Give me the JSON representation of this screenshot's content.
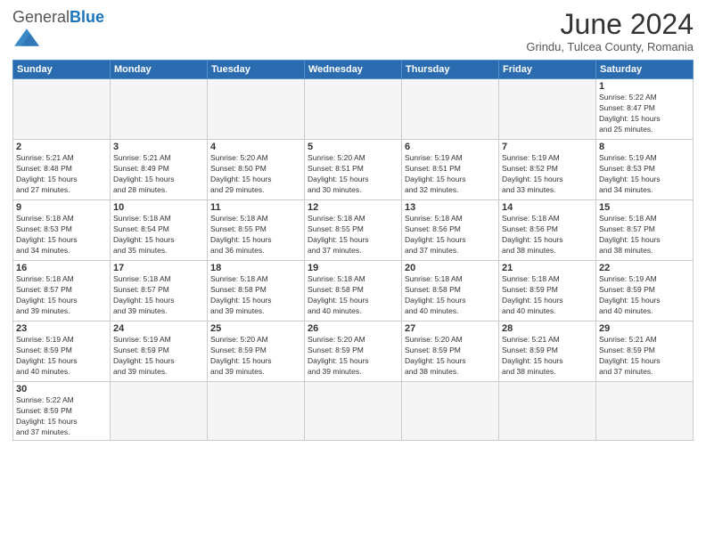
{
  "header": {
    "logo_general": "General",
    "logo_blue": "Blue",
    "month_year": "June 2024",
    "location": "Grindu, Tulcea County, Romania"
  },
  "weekdays": [
    "Sunday",
    "Monday",
    "Tuesday",
    "Wednesday",
    "Thursday",
    "Friday",
    "Saturday"
  ],
  "weeks": [
    [
      {
        "day": "",
        "info": ""
      },
      {
        "day": "",
        "info": ""
      },
      {
        "day": "",
        "info": ""
      },
      {
        "day": "",
        "info": ""
      },
      {
        "day": "",
        "info": ""
      },
      {
        "day": "",
        "info": ""
      },
      {
        "day": "1",
        "info": "Sunrise: 5:22 AM\nSunset: 8:47 PM\nDaylight: 15 hours\nand 25 minutes."
      }
    ],
    [
      {
        "day": "2",
        "info": "Sunrise: 5:21 AM\nSunset: 8:48 PM\nDaylight: 15 hours\nand 27 minutes."
      },
      {
        "day": "3",
        "info": "Sunrise: 5:21 AM\nSunset: 8:49 PM\nDaylight: 15 hours\nand 28 minutes."
      },
      {
        "day": "4",
        "info": "Sunrise: 5:20 AM\nSunset: 8:50 PM\nDaylight: 15 hours\nand 29 minutes."
      },
      {
        "day": "5",
        "info": "Sunrise: 5:20 AM\nSunset: 8:51 PM\nDaylight: 15 hours\nand 30 minutes."
      },
      {
        "day": "6",
        "info": "Sunrise: 5:19 AM\nSunset: 8:51 PM\nDaylight: 15 hours\nand 32 minutes."
      },
      {
        "day": "7",
        "info": "Sunrise: 5:19 AM\nSunset: 8:52 PM\nDaylight: 15 hours\nand 33 minutes."
      },
      {
        "day": "8",
        "info": "Sunrise: 5:19 AM\nSunset: 8:53 PM\nDaylight: 15 hours\nand 34 minutes."
      }
    ],
    [
      {
        "day": "9",
        "info": "Sunrise: 5:18 AM\nSunset: 8:53 PM\nDaylight: 15 hours\nand 34 minutes."
      },
      {
        "day": "10",
        "info": "Sunrise: 5:18 AM\nSunset: 8:54 PM\nDaylight: 15 hours\nand 35 minutes."
      },
      {
        "day": "11",
        "info": "Sunrise: 5:18 AM\nSunset: 8:55 PM\nDaylight: 15 hours\nand 36 minutes."
      },
      {
        "day": "12",
        "info": "Sunrise: 5:18 AM\nSunset: 8:55 PM\nDaylight: 15 hours\nand 37 minutes."
      },
      {
        "day": "13",
        "info": "Sunrise: 5:18 AM\nSunset: 8:56 PM\nDaylight: 15 hours\nand 37 minutes."
      },
      {
        "day": "14",
        "info": "Sunrise: 5:18 AM\nSunset: 8:56 PM\nDaylight: 15 hours\nand 38 minutes."
      },
      {
        "day": "15",
        "info": "Sunrise: 5:18 AM\nSunset: 8:57 PM\nDaylight: 15 hours\nand 38 minutes."
      }
    ],
    [
      {
        "day": "16",
        "info": "Sunrise: 5:18 AM\nSunset: 8:57 PM\nDaylight: 15 hours\nand 39 minutes."
      },
      {
        "day": "17",
        "info": "Sunrise: 5:18 AM\nSunset: 8:57 PM\nDaylight: 15 hours\nand 39 minutes."
      },
      {
        "day": "18",
        "info": "Sunrise: 5:18 AM\nSunset: 8:58 PM\nDaylight: 15 hours\nand 39 minutes."
      },
      {
        "day": "19",
        "info": "Sunrise: 5:18 AM\nSunset: 8:58 PM\nDaylight: 15 hours\nand 40 minutes."
      },
      {
        "day": "20",
        "info": "Sunrise: 5:18 AM\nSunset: 8:58 PM\nDaylight: 15 hours\nand 40 minutes."
      },
      {
        "day": "21",
        "info": "Sunrise: 5:18 AM\nSunset: 8:59 PM\nDaylight: 15 hours\nand 40 minutes."
      },
      {
        "day": "22",
        "info": "Sunrise: 5:19 AM\nSunset: 8:59 PM\nDaylight: 15 hours\nand 40 minutes."
      }
    ],
    [
      {
        "day": "23",
        "info": "Sunrise: 5:19 AM\nSunset: 8:59 PM\nDaylight: 15 hours\nand 40 minutes."
      },
      {
        "day": "24",
        "info": "Sunrise: 5:19 AM\nSunset: 8:59 PM\nDaylight: 15 hours\nand 39 minutes."
      },
      {
        "day": "25",
        "info": "Sunrise: 5:20 AM\nSunset: 8:59 PM\nDaylight: 15 hours\nand 39 minutes."
      },
      {
        "day": "26",
        "info": "Sunrise: 5:20 AM\nSunset: 8:59 PM\nDaylight: 15 hours\nand 39 minutes."
      },
      {
        "day": "27",
        "info": "Sunrise: 5:20 AM\nSunset: 8:59 PM\nDaylight: 15 hours\nand 38 minutes."
      },
      {
        "day": "28",
        "info": "Sunrise: 5:21 AM\nSunset: 8:59 PM\nDaylight: 15 hours\nand 38 minutes."
      },
      {
        "day": "29",
        "info": "Sunrise: 5:21 AM\nSunset: 8:59 PM\nDaylight: 15 hours\nand 37 minutes."
      }
    ],
    [
      {
        "day": "30",
        "info": "Sunrise: 5:22 AM\nSunset: 8:59 PM\nDaylight: 15 hours\nand 37 minutes."
      },
      {
        "day": "",
        "info": ""
      },
      {
        "day": "",
        "info": ""
      },
      {
        "day": "",
        "info": ""
      },
      {
        "day": "",
        "info": ""
      },
      {
        "day": "",
        "info": ""
      },
      {
        "day": "",
        "info": ""
      }
    ]
  ]
}
